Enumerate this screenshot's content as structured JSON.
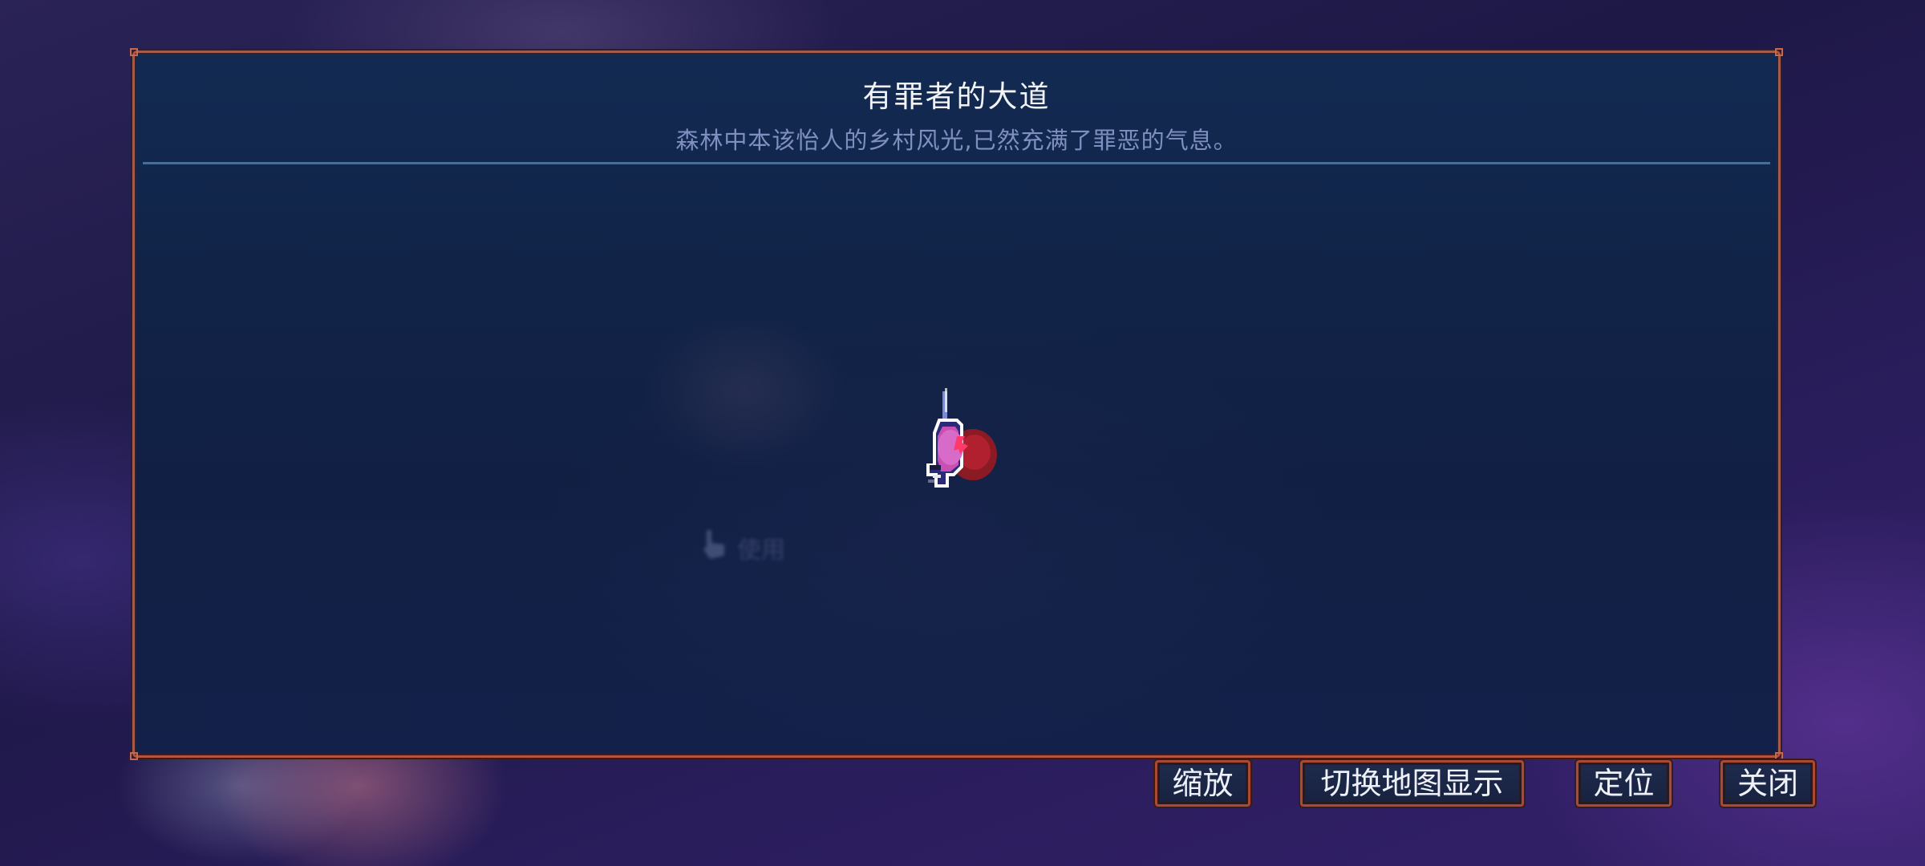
{
  "map": {
    "title": "有罪者的大道",
    "subtitle": "森林中本该怡人的乡村风光,已然充满了罪恶的气息。",
    "hint_text": "使用"
  },
  "buttons": {
    "zoom": "缩放",
    "toggle_map_display": "切换地图显示",
    "locate": "定位",
    "close": "关闭"
  },
  "colors": {
    "panel_border": "#b5553f",
    "panel_background": "#122a52",
    "title_text": "#f2f3f7",
    "subtitle_text": "#7f8fc0",
    "player_marker_pink": "#d257b8",
    "player_marker_red": "#8a1a24"
  },
  "icons": {
    "player_marker": "player-marker-icon",
    "hint": "hand-pointer-icon"
  }
}
